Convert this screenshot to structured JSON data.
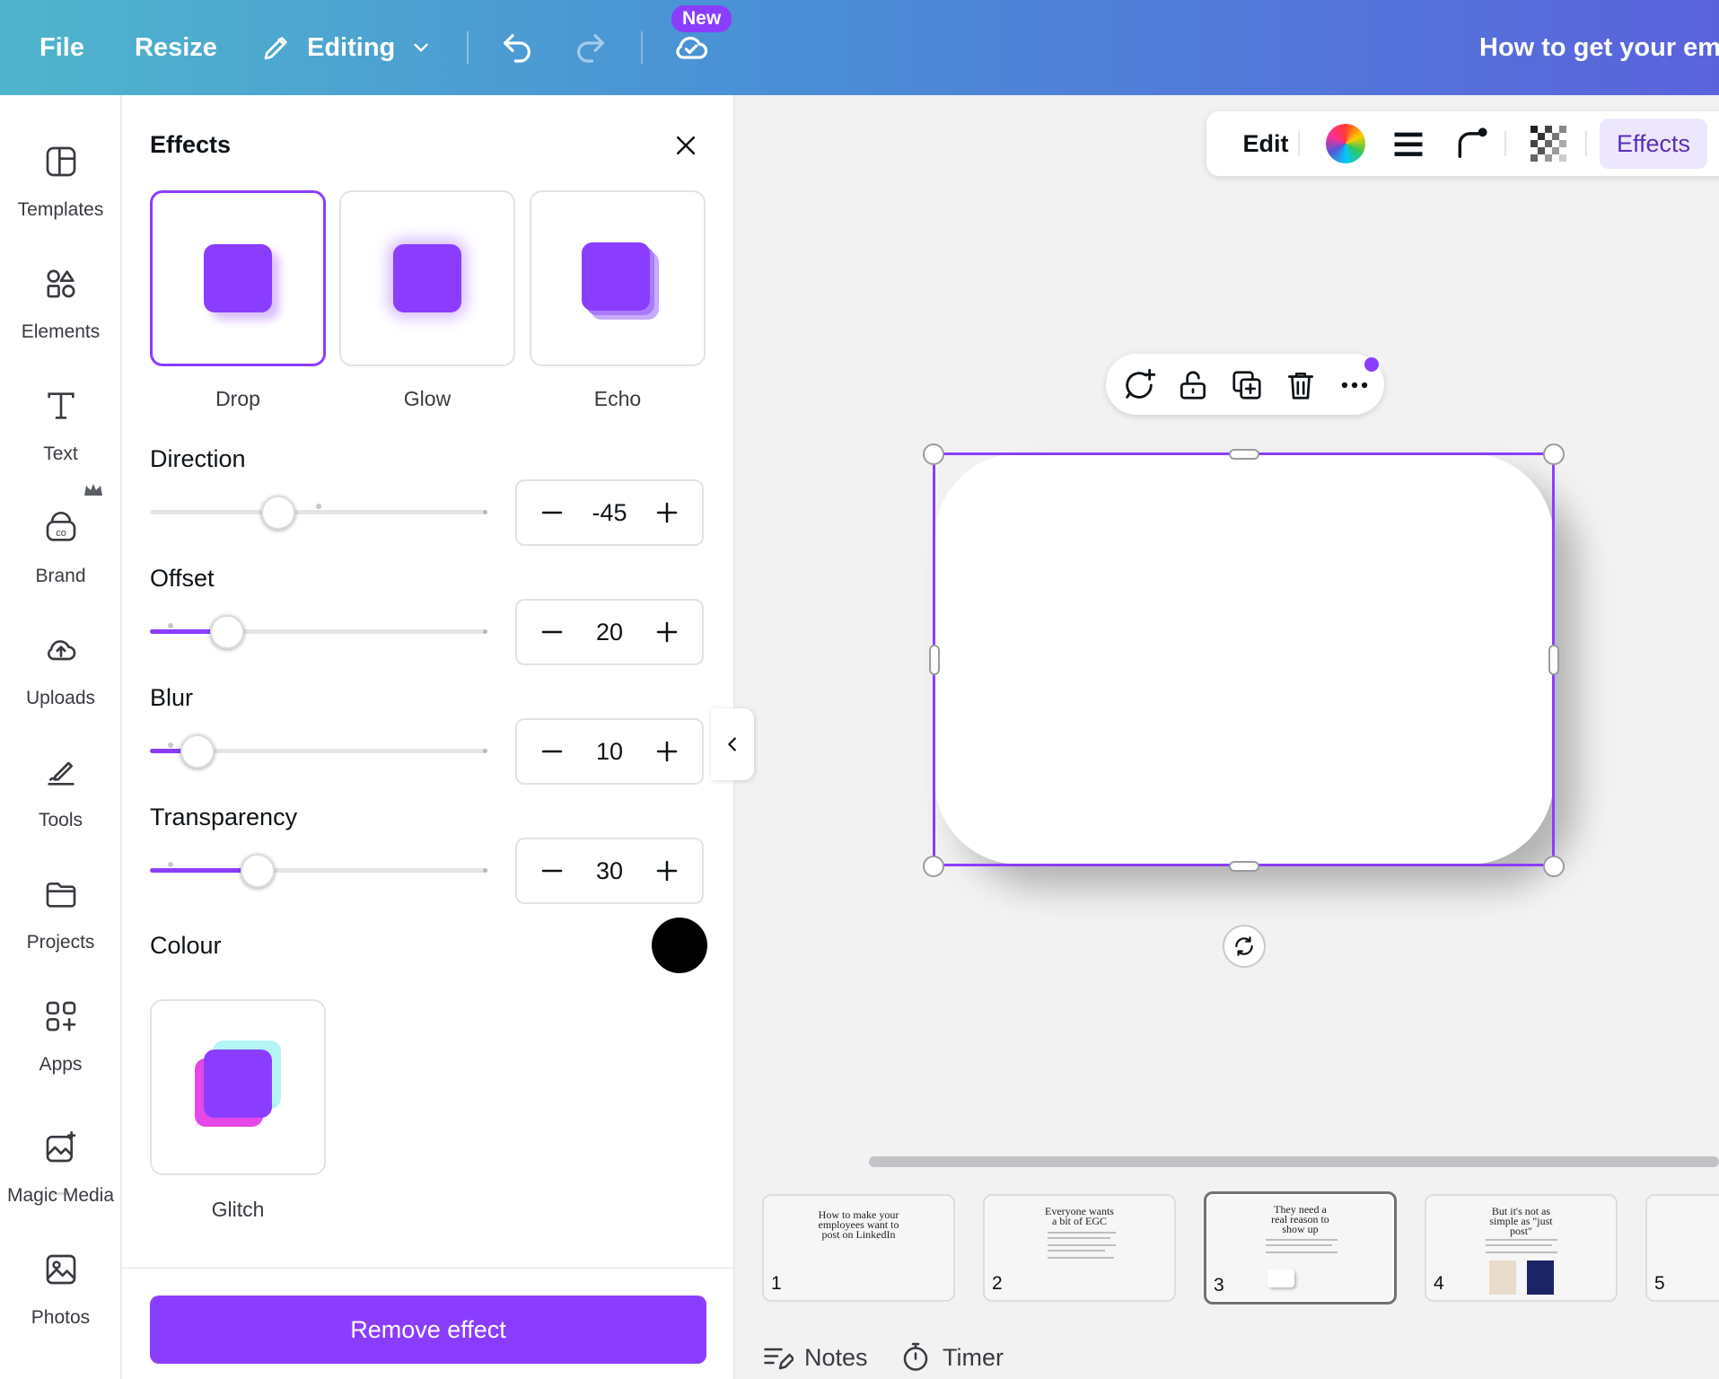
{
  "topbar": {
    "file": "File",
    "resize": "Resize",
    "editing": "Editing",
    "new_badge": "New",
    "doc_title": "How to get your emp"
  },
  "rail": {
    "items": [
      {
        "label": "Templates",
        "icon": "templates-icon"
      },
      {
        "label": "Elements",
        "icon": "elements-icon"
      },
      {
        "label": "Text",
        "icon": "text-icon"
      },
      {
        "label": "Brand",
        "icon": "brand-icon"
      },
      {
        "label": "Uploads",
        "icon": "uploads-icon"
      },
      {
        "label": "Tools",
        "icon": "tools-icon"
      },
      {
        "label": "Projects",
        "icon": "projects-icon"
      },
      {
        "label": "Apps",
        "icon": "apps-icon"
      },
      {
        "label": "Magic Media",
        "icon": "magic-media-icon"
      },
      {
        "label": "Photos",
        "icon": "photos-icon"
      }
    ]
  },
  "panel": {
    "title": "Effects",
    "effects": [
      {
        "label": "Drop",
        "selected": true
      },
      {
        "label": "Glow",
        "selected": false
      },
      {
        "label": "Echo",
        "selected": false
      },
      {
        "label": "Glitch",
        "selected": false
      }
    ],
    "controls": {
      "direction": {
        "label": "Direction",
        "value": "-45",
        "fraction": 0.38
      },
      "offset": {
        "label": "Offset",
        "value": "20",
        "fraction": 0.23
      },
      "blur": {
        "label": "Blur",
        "value": "10",
        "fraction": 0.14
      },
      "transparency": {
        "label": "Transparency",
        "value": "30",
        "fraction": 0.32
      }
    },
    "colour_label": "Colour",
    "colour_value": "#000000",
    "remove_label": "Remove effect"
  },
  "context_toolbar": {
    "edit": "Edit",
    "effects": "Effects"
  },
  "pages": [
    {
      "num": "1",
      "title": "How to make your employees want to post on LinkedIn"
    },
    {
      "num": "2",
      "title": "Everyone wants a bit of EGC"
    },
    {
      "num": "3",
      "title": "They need a real reason to show up",
      "current": true
    },
    {
      "num": "4",
      "title": "But it's not as simple as \"just post\""
    },
    {
      "num": "5",
      "title": ""
    }
  ],
  "footer": {
    "notes": "Notes",
    "timer": "Timer"
  },
  "colors": {
    "accent": "#8b3dff"
  }
}
